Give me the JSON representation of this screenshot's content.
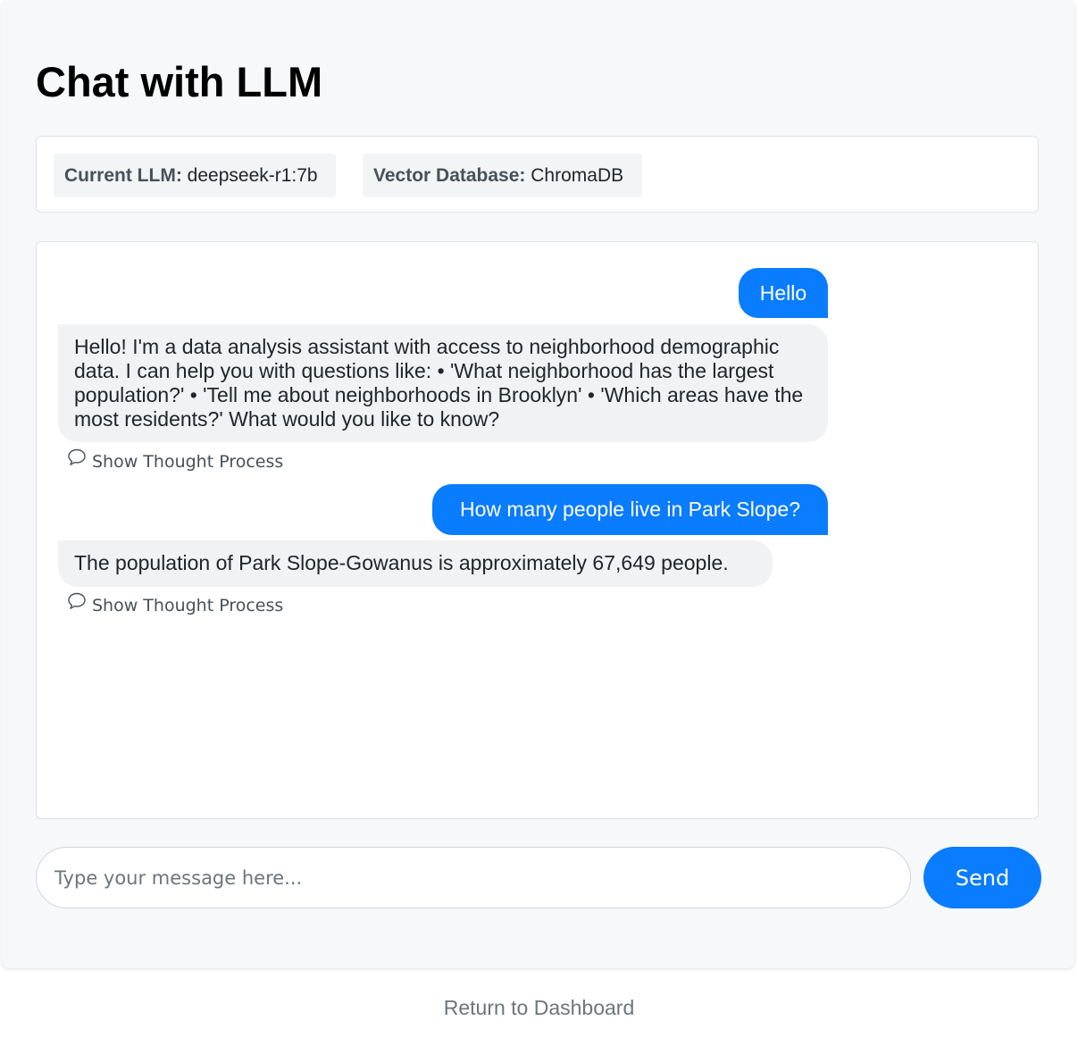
{
  "header": {
    "title": "Chat with LLM"
  },
  "info": {
    "llm_label": "Current LLM:",
    "llm_value": "deepseek-r1:7b",
    "db_label": "Vector Database:",
    "db_value": "ChromaDB"
  },
  "chat": {
    "messages": [
      {
        "role": "user",
        "text": "Hello"
      },
      {
        "role": "assistant",
        "text": "Hello! I'm a data analysis assistant with access to neighborhood demographic data. I can help you with questions like: • 'What neighborhood has the largest population?' • 'Tell me about neighborhoods in Brooklyn' • 'Which areas have the most residents?' What would you like to know?",
        "thought_toggle": "Show Thought Process"
      },
      {
        "role": "user",
        "text": "How many people live in Park Slope?"
      },
      {
        "role": "assistant",
        "text": "The population of Park Slope-Gowanus is approximately 67,649 people.",
        "thought_toggle": "Show Thought Process"
      }
    ]
  },
  "composer": {
    "placeholder": "Type your message here...",
    "value": "",
    "send_label": "Send"
  },
  "footer": {
    "return_link": "Return to Dashboard"
  },
  "colors": {
    "accent": "#0a7cff",
    "page_background": "#f7f8fa",
    "bot_bubble": "#f1f2f4",
    "muted_text": "#6c757d"
  },
  "icons": {
    "thought": "thought-bubble-icon"
  }
}
